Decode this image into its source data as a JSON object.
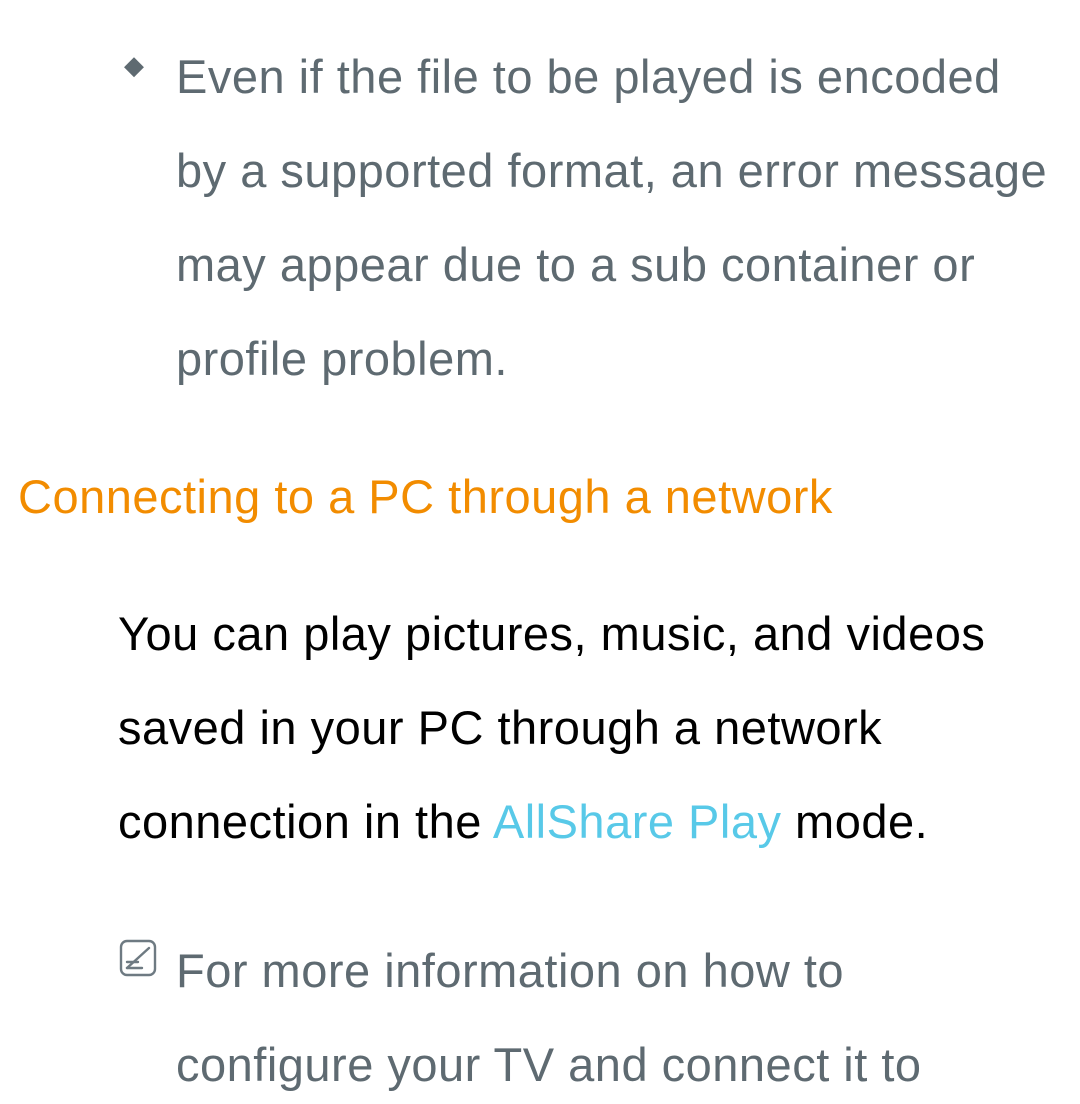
{
  "bullet": {
    "text": "Even if the file to be played is encoded by a supported format, an error message may appear due to a sub container or profile problem."
  },
  "heading": "Connecting to a PC through a network",
  "paragraph": {
    "pre": "You can play pictures, music, and videos saved in your PC through a network connection in the ",
    "link": "AllShare Play",
    "post": " mode."
  },
  "note": {
    "text": "For more information on how to configure your TV and connect it to"
  }
}
